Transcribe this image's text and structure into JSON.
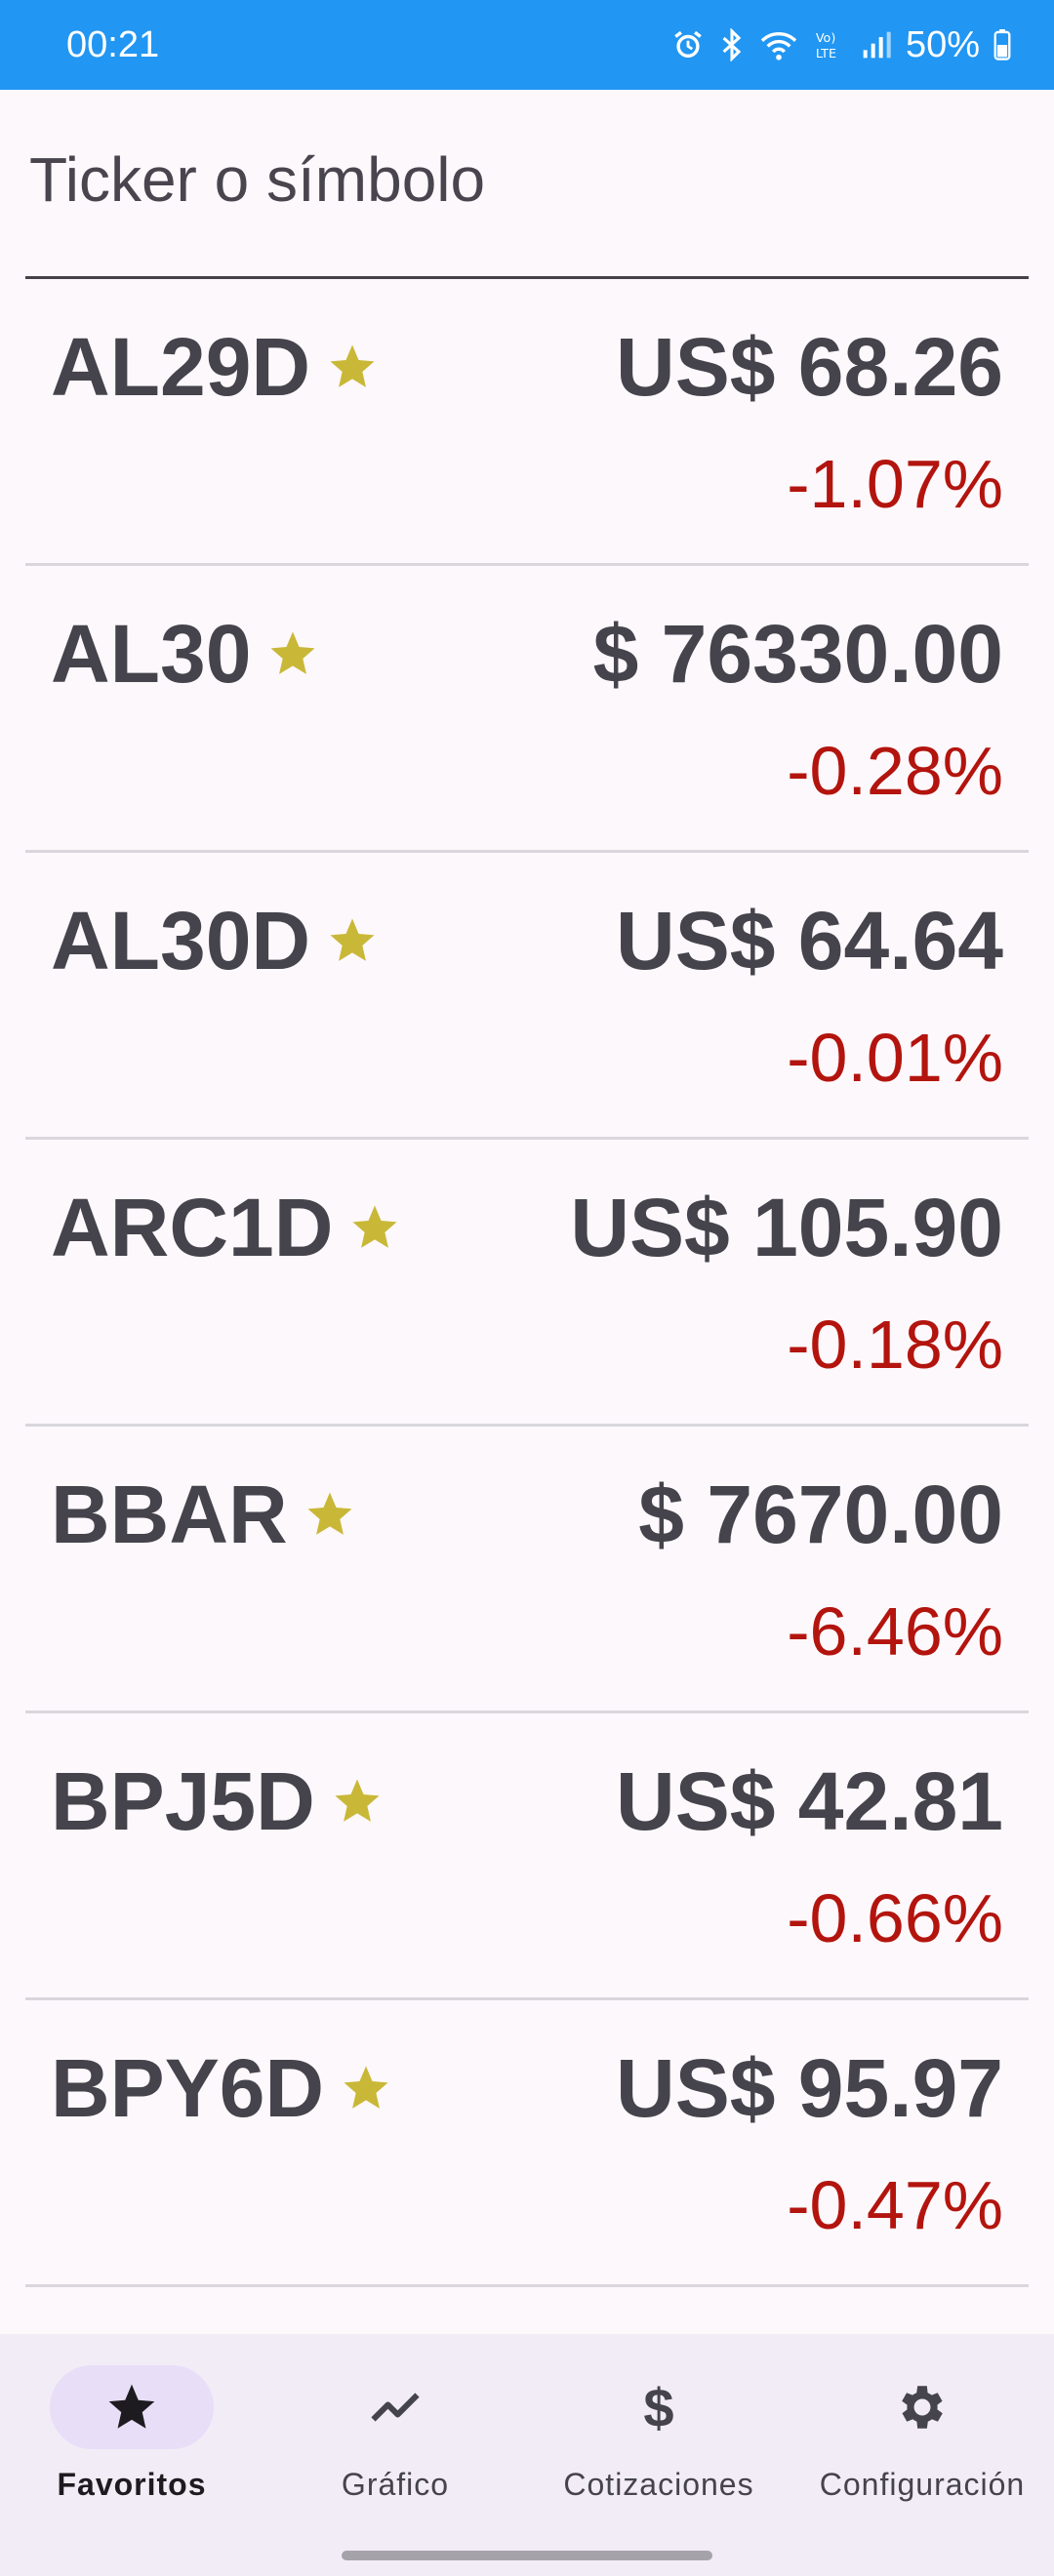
{
  "status_bar": {
    "time": "00:21",
    "battery": "50%",
    "icons": [
      "alarm-icon",
      "bluetooth-icon",
      "wifi-icon",
      "volte-icon",
      "signal-icon",
      "battery-icon"
    ]
  },
  "search": {
    "placeholder": "Ticker o símbolo",
    "value": ""
  },
  "colors": {
    "status_bar": "#2196F3",
    "star": "#C9B837",
    "negative": "#B3140E",
    "text": "#45434B",
    "nav_active_pill": "#E8DEF8"
  },
  "favorites": [
    {
      "ticker": "AL29D",
      "price": "US$ 68.26",
      "change": "-1.07%"
    },
    {
      "ticker": "AL30",
      "price": "$ 76330.00",
      "change": "-0.28%"
    },
    {
      "ticker": "AL30D",
      "price": "US$ 64.64",
      "change": "-0.01%"
    },
    {
      "ticker": "ARC1D",
      "price": "US$ 105.90",
      "change": "-0.18%"
    },
    {
      "ticker": "BBAR",
      "price": "$ 7670.00",
      "change": "-6.46%"
    },
    {
      "ticker": "BPJ5D",
      "price": "US$ 42.81",
      "change": "-0.66%"
    },
    {
      "ticker": "BPY6D",
      "price": "US$ 95.97",
      "change": "-0.47%"
    }
  ],
  "nav": {
    "items": [
      {
        "label": "Favoritos",
        "icon": "star-icon",
        "active": true
      },
      {
        "label": "Gráfico",
        "icon": "chart-line-icon",
        "active": false
      },
      {
        "label": "Cotizaciones",
        "icon": "dollar-icon",
        "active": false
      },
      {
        "label": "Configuración",
        "icon": "gear-icon",
        "active": false
      }
    ]
  }
}
